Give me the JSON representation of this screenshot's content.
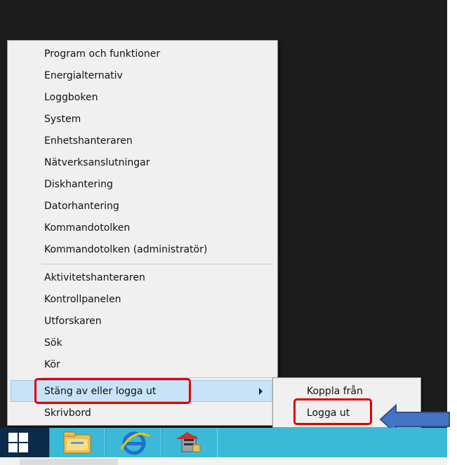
{
  "menu": {
    "group1": [
      "Program och funktioner",
      "Energialternativ",
      "Loggboken",
      "System",
      "Enhetshanteraren",
      "Nätverksanslutningar",
      "Diskhantering",
      "Datorhantering",
      "Kommandotolken",
      "Kommandotolken (administratör)"
    ],
    "group2": [
      "Aktivitetshanteraren",
      "Kontrollpanelen",
      "Utforskaren",
      "Sök",
      "Kör"
    ],
    "group3": [
      "Stäng av eller logga ut",
      "Skrivbord"
    ]
  },
  "submenu": {
    "items": [
      "Koppla från",
      "Logga ut"
    ]
  },
  "taskbar": {
    "icons": [
      "windows-logo-icon",
      "file-explorer-icon",
      "internet-explorer-icon",
      "server-manager-icon"
    ]
  },
  "colors": {
    "highlight": "#e00000",
    "arrow": "#4472c4",
    "taskbar": "#3cb9d6",
    "start": "#0c2a4a"
  }
}
